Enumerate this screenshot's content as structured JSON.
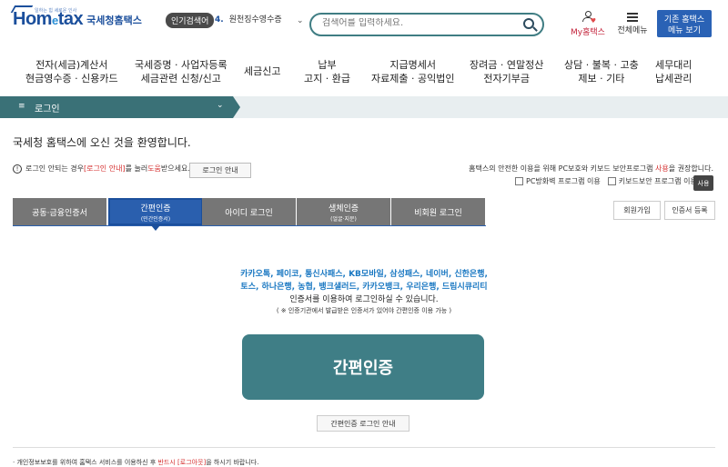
{
  "logo": {
    "sub": "일하는 힘 세로운 인사",
    "brand_main": "Hom",
    "brand_e": "e",
    "brand_tail": "tax",
    "brand_kr": "국세청홈택스"
  },
  "popular": {
    "badge": "인기검색어",
    "number": "4.",
    "item": "원천징수영수증",
    "arrow": "⌄"
  },
  "search": {
    "placeholder": "검색어를 입력하세요."
  },
  "my_hometax": {
    "label": "My홈택스"
  },
  "all_menu": {
    "label": "전체메뉴"
  },
  "old_menu": {
    "line1": "기존 홈택스",
    "line2": "메뉴 보기"
  },
  "gnb": [
    {
      "line1": "전자(세금)계산서",
      "line2": "현금영수증 · 신용카드"
    },
    {
      "line1": "국세증명 · 사업자등록",
      "line2": "세금관련 신청/신고"
    },
    {
      "line1": "세금신고",
      "line2": ""
    },
    {
      "line1": "납부",
      "line2": "고지 · 환급"
    },
    {
      "line1": "지급명세서",
      "line2": "자료제출 · 공익법인"
    },
    {
      "line1": "장려금 · 연말정산",
      "line2": "전자기부금"
    },
    {
      "line1": "상담 · 불복 · 고충",
      "line2": "제보 · 기타"
    },
    {
      "line1": "세무대리",
      "line2": "납세관리"
    }
  ],
  "breadcrumb": {
    "icon": "≡",
    "label": "로그인",
    "chevron": "⌄"
  },
  "welcome": "국세청 홈택스에 오신 것을 환영합니다.",
  "notice": {
    "icon": "!",
    "part1": "로그인 안되는 경우 ",
    "link": "[로그인 안내]",
    "part2": "를 눌러 ",
    "help": "도움",
    "part3": "받으세요.",
    "guide_button": "로그인 안내"
  },
  "recommend": {
    "part1": "홈택스의 안전한 이용을 위해 PC보호와 키보드 보안프로그램 ",
    "use": "사용",
    "part2": "을 권장합니다."
  },
  "programs": {
    "pc": "PC방화벽 프로그램 이용",
    "keyboard": "키보드보안 프로그램 이용",
    "use_button": "사용"
  },
  "tabs": [
    {
      "label": "공동·금융인증서",
      "sub": ""
    },
    {
      "label": "간편인증",
      "sub": "(민간인증서)"
    },
    {
      "label": "아이디 로그인",
      "sub": ""
    },
    {
      "label": "생체인증",
      "sub": "(얼굴·지문)"
    },
    {
      "label": "비회원 로그인",
      "sub": ""
    }
  ],
  "side_buttons": {
    "join": "회원가입",
    "cert": "인증서 등록"
  },
  "providers": [
    "카카오톡, 페이코, 통신사패스, KB모바일, 삼성패스, 네이버, 신한은행,",
    "토스, 하나은행, 농협, 뱅크샐러드, 카카오뱅크, 우리은행, 드림시큐리티"
  ],
  "provider_desc": "인증서를 이용하여 로그인하실 수 있습니다.",
  "provider_note": "( ※ 인증기관에서 발급받은 인증서가 있어야 간편인증 이용 가능 )",
  "simple_button": "간편인증",
  "simple_guide_button": "간편인증 로그인 안내",
  "footer": {
    "part1": "· 개인정보보호를 위하여 홈택스 서비스를 이용하신 후 ",
    "highlight": "반드시 [로그아웃]",
    "part2": "을 하시기 바랍니다."
  }
}
